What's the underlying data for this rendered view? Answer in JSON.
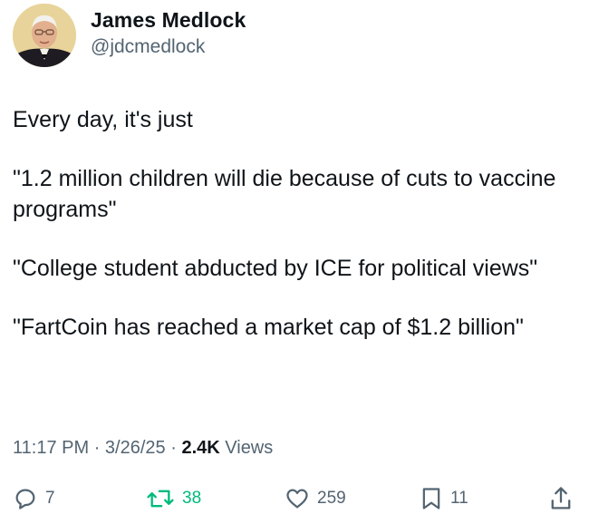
{
  "author": {
    "display_name": "James Medlock",
    "handle": "@jdcmedlock",
    "avatar_icon": "profile-photo"
  },
  "tweet": {
    "paragraphs": [
      "Every day, it's just",
      "\"1.2 million children will die because of cuts to vaccine programs\"",
      "\"College student abducted by ICE for political views\"",
      "\"FartCoin has reached a market cap of $1.2 billion\""
    ]
  },
  "meta": {
    "time": "11:17 PM",
    "sep": "·",
    "date": "3/26/25",
    "views_count": "2.4K",
    "views_label": "Views"
  },
  "actions": {
    "replies": "7",
    "retweets": "38",
    "likes": "259",
    "bookmarks": "11"
  },
  "colors": {
    "text": "#0f1419",
    "secondary": "#536471",
    "retweet_active": "#00ba7c"
  }
}
